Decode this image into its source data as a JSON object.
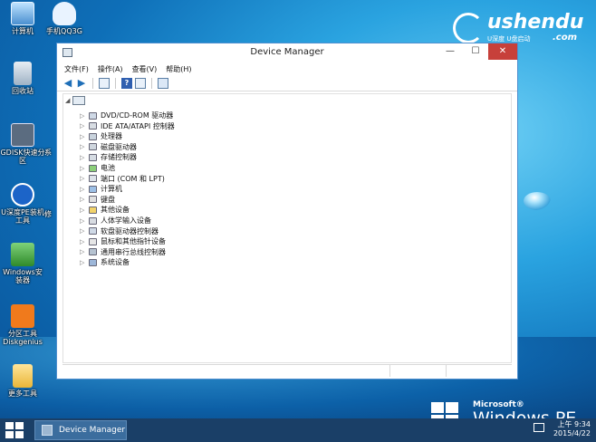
{
  "desktop": {
    "icons": [
      {
        "label": "计算机"
      },
      {
        "label": "手机QQ3G"
      },
      {
        "label": "回收站"
      },
      {
        "label": "GDISK快速分区"
      },
      {
        "label": "系"
      },
      {
        "label": "U深度PE装机工具"
      },
      {
        "label": "修"
      },
      {
        "label": "Windows安装器"
      },
      {
        "label": "分区工具Diskgenius"
      },
      {
        "label": "更多工具"
      }
    ]
  },
  "logo": {
    "brand": "ushendu",
    "subtitle": "U深度 U盘启动",
    "domain": ".com"
  },
  "window": {
    "title": "Device Manager",
    "minimize": "—",
    "maximize": "☐",
    "close": "✕",
    "menu": [
      "文件(F)",
      "操作(A)",
      "查看(V)",
      "帮助(H)"
    ],
    "tree_items": [
      "DVD/CD-ROM 驱动器",
      "IDE ATA/ATAPI 控制器",
      "处理器",
      "磁盘驱动器",
      "存储控制器",
      "电池",
      "端口 (COM 和 LPT)",
      "计算机",
      "键盘",
      "其他设备",
      "人体学输入设备",
      "软盘驱动器控制器",
      "鼠标和其他指针设备",
      "通用串行总线控制器",
      "系统设备"
    ]
  },
  "branding": {
    "microsoft": "Microsoft®",
    "windows_pe": "Windows PE"
  },
  "taskbar": {
    "task_label": "Device Manager",
    "time": "上午 9:34",
    "date": "2015/4/22"
  }
}
